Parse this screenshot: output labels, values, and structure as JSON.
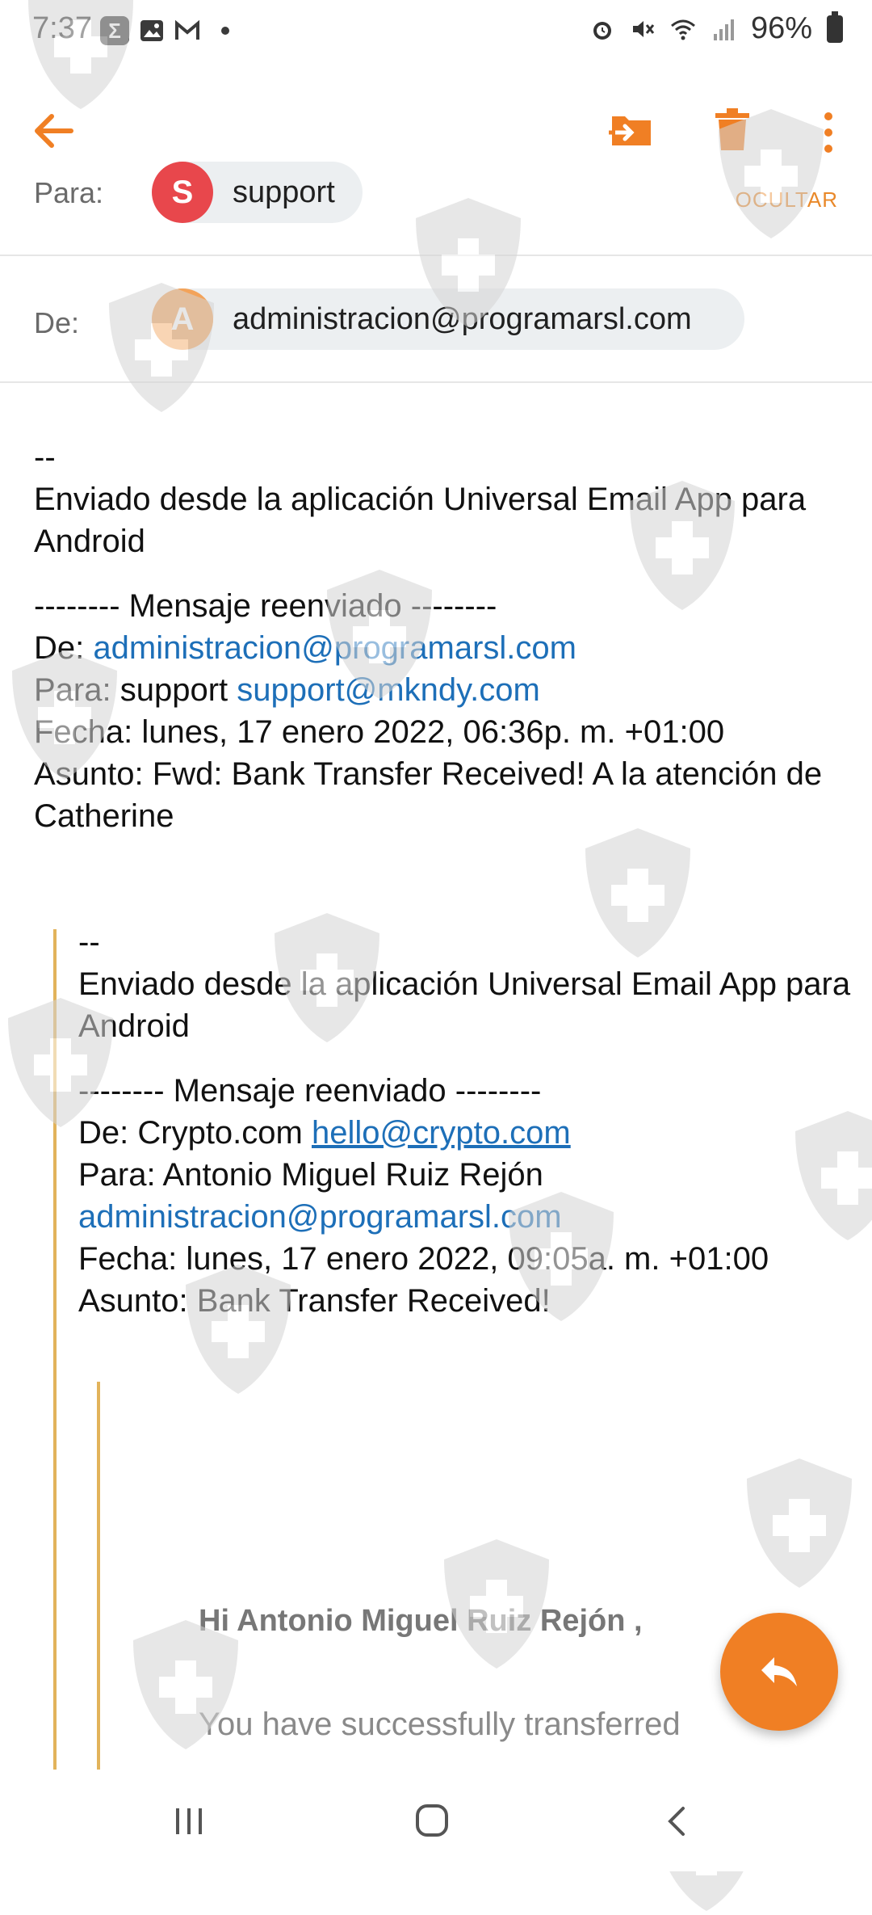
{
  "status_bar": {
    "time": "7:37",
    "left_icons": [
      "sigma-icon",
      "image-icon",
      "gmail-icon"
    ],
    "battery": "96%"
  },
  "toolbar": {
    "back_icon": "arrow-back-icon",
    "move_icon": "move-to-folder-icon",
    "delete_icon": "trash-icon",
    "more_icon": "more-vert-icon",
    "accent": "#f07f24"
  },
  "header": {
    "to_label": "Para:",
    "to_avatar": "S",
    "to_name": "support",
    "hide_label": "OCULTAR",
    "from_label": "De:",
    "from_avatar": "A",
    "from_email": "administracion@programarsl.com"
  },
  "body": {
    "sig_dashes": "--",
    "sig_text": "Enviado desde la aplicación Universal Email App para Android",
    "fwd_header": "-------- Mensaje reenviado --------",
    "de_label": "De:",
    "de_email": "administracion@programarsl.com",
    "para_label": "Para: support",
    "para_email": "support@mkndy.com",
    "fecha": "Fecha: lunes, 17 enero 2022, 06:36p. m. +01:00",
    "asunto": "Asunto: Fwd: Bank Transfer Received! A la atención de Catherine"
  },
  "quoted": {
    "sig_dashes": "--",
    "sig_text": "Enviado desde la aplicación Universal Email App para Android",
    "fwd_header": "-------- Mensaje reenviado --------",
    "de_label": "De: Crypto.com",
    "de_email": "hello@crypto.com",
    "para_label": "Para: Antonio Miguel Ruiz Rejón",
    "para_email": "administracion@programarsl.com",
    "fecha": "Fecha: lunes, 17 enero 2022, 09:05a. m. +01:00",
    "asunto": "Asunto: Bank Transfer Received!"
  },
  "inner": {
    "greeting": "Hi Antonio Miguel Ruiz Rejón ,",
    "snippet": "You have successfully transferred"
  },
  "fab": {
    "icon": "reply-icon"
  },
  "nav": {
    "recent_icon": "recents-icon",
    "home_icon": "home-icon",
    "back_icon": "nav-back-icon"
  }
}
